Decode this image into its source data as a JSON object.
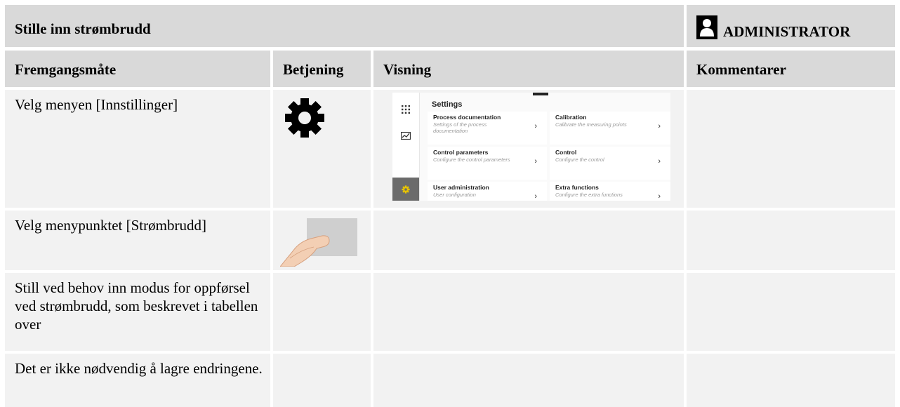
{
  "header": {
    "title": "Stille inn strømbrudd",
    "role": "ADMINISTRATOR"
  },
  "columns": [
    "Fremgangsmåte",
    "Betjening",
    "Visning",
    "Kommentarer"
  ],
  "rows": [
    {
      "step": "Velg menyen [Innstillinger]",
      "operation_icon": "gear-icon",
      "comment": ""
    },
    {
      "step": "Velg menypunktet [Strømbrudd]",
      "operation_icon": "finger-tap-icon",
      "comment": ""
    },
    {
      "step": "Still ved behov inn modus for oppførsel ved strømbrudd, som beskrevet i tabellen over",
      "operation_icon": "",
      "comment": ""
    },
    {
      "step": "Det er ikke nødvendig å lagre endringene.",
      "operation_icon": "",
      "comment": ""
    }
  ],
  "screen": {
    "title": "Settings",
    "sidebar_icons": [
      "apps-grid-icon",
      "chart-icon",
      "gear-icon"
    ],
    "accent": "#e8c400",
    "cards": [
      {
        "title": "Process documentation",
        "desc": "Settings of the process documentation"
      },
      {
        "title": "Calibration",
        "desc": "Calibrate the measuring points"
      },
      {
        "title": "Control parameters",
        "desc": "Configure the control parameters"
      },
      {
        "title": "Control",
        "desc": "Configure the control"
      },
      {
        "title": "User administration",
        "desc": "User configuration"
      },
      {
        "title": "Extra functions",
        "desc": "Configure the extra functions"
      }
    ]
  }
}
